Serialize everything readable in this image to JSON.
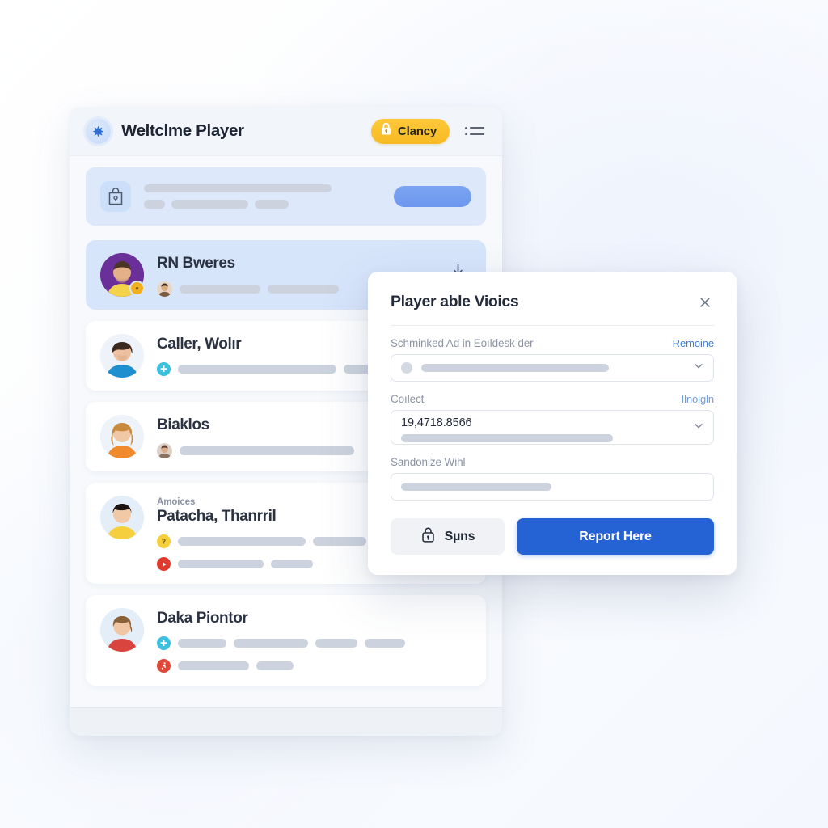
{
  "app": {
    "title": "Weltclme Player",
    "logo_icon": "star-burst-icon",
    "chip": {
      "label": "Clancy",
      "icon": "lock-icon",
      "color": "#f7ba22"
    },
    "menu_icon": "hamburger-menu-icon"
  },
  "promo": {
    "icon": "shopping-bag-lock-icon",
    "button_color": "#6d97ee"
  },
  "rows": [
    {
      "kicker": "",
      "name": "RN Bweres",
      "selected": true,
      "avatar_bg": "#6a2f99",
      "avatar_shirt": "#f2d34b",
      "avatar_skin": "#e3b089",
      "avatar_hair": "#4a3527",
      "status_dot": true,
      "arrow_icon": "arrow-down-icon",
      "meta": [
        {
          "badge": "avatar-thumb-icon",
          "badge_color": "#b6742f",
          "bars": [
            100,
            88
          ]
        }
      ]
    },
    {
      "kicker": "",
      "name": "Caller, Wolır",
      "selected": false,
      "avatar_bg": "#eef3fa",
      "avatar_shirt": "#1f8fd0",
      "avatar_skin": "#ecc0a0",
      "avatar_hair": "#3d2a1e",
      "status_dot": false,
      "meta": [
        {
          "badge": "medical-cross-icon",
          "badge_color": "#3bc0e0",
          "bars": [
            196,
            62
          ]
        }
      ]
    },
    {
      "kicker": "",
      "name": "Biaklos",
      "selected": false,
      "avatar_bg": "#eef3fa",
      "avatar_shirt": "#f08a2c",
      "avatar_skin": "#f0c8a6",
      "avatar_hair": "#c98a3e",
      "status_dot": false,
      "meta": [
        {
          "badge": "avatar-thumb-icon",
          "badge_color": "#c0a090",
          "bars": [
            216
          ]
        }
      ]
    },
    {
      "kicker": "Amoices",
      "name": "Patacha, Thanrril",
      "selected": false,
      "avatar_bg": "#e4eef8",
      "avatar_shirt": "#f5cf3e",
      "avatar_skin": "#f2c9a6",
      "avatar_hair": "#1c1410",
      "status_dot": false,
      "meta": [
        {
          "badge": "question-mark-icon",
          "badge_color": "#f5cf3e",
          "bars": [
            158,
            66
          ]
        },
        {
          "badge": "play-icon",
          "badge_color": "#e03a2f",
          "bars": [
            106,
            52
          ]
        }
      ]
    },
    {
      "kicker": "",
      "name": "Daka Piontor",
      "selected": false,
      "avatar_bg": "#e4eef8",
      "avatar_shirt": "#d9453e",
      "avatar_skin": "#f0c6a4",
      "avatar_hair": "#8a6038",
      "status_dot": false,
      "meta": [
        {
          "badge": "medical-cross-icon",
          "badge_color": "#3bc0e0",
          "bars": [
            60,
            92,
            52,
            50
          ]
        },
        {
          "badge": "running-icon",
          "badge_color": "#e0493a",
          "bars": [
            88,
            46
          ]
        }
      ]
    }
  ],
  "modal": {
    "title": "Player able Vioics",
    "close_icon": "close-icon",
    "fields": [
      {
        "label": "Schminked Ad in Eoıldesk der",
        "link": "Remoine",
        "type": "select-skeleton",
        "value": "",
        "chevron_icon": "chevron-down-icon"
      },
      {
        "label": "Coılect",
        "link": "Ilnoigln",
        "type": "select-value",
        "value": "19,4718.8566",
        "chevron_icon": "chevron-down-icon"
      },
      {
        "label": "Sandonize Wihl",
        "link": "",
        "type": "text-skeleton",
        "value": "",
        "chevron_icon": ""
      }
    ],
    "secondary_button": {
      "label": "Sµns",
      "icon": "lock-icon"
    },
    "primary_button": {
      "label": "Report Here",
      "color": "#2563d4"
    }
  }
}
